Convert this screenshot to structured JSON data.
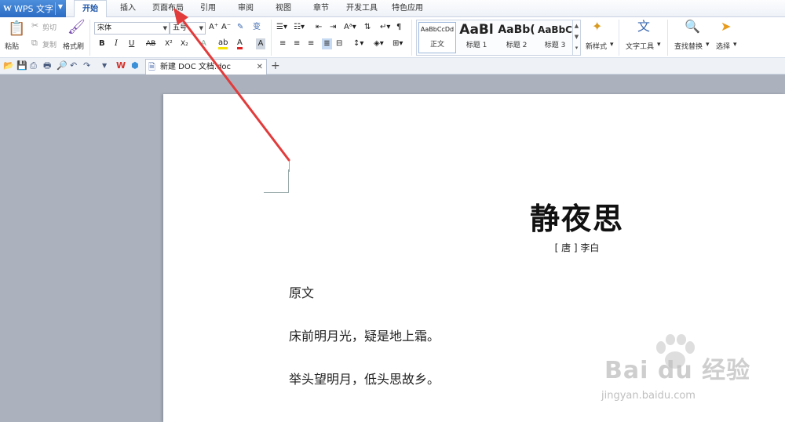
{
  "app": {
    "menu_button_label": "WPS 文字",
    "tabs": [
      {
        "label": "开始",
        "active": true
      },
      {
        "label": "插入"
      },
      {
        "label": "页面布局"
      },
      {
        "label": "引用"
      },
      {
        "label": "审阅"
      },
      {
        "label": "视图"
      },
      {
        "label": "章节"
      },
      {
        "label": "开发工具"
      },
      {
        "label": "特色应用"
      }
    ]
  },
  "ribbon": {
    "paste_label": "粘贴",
    "cut_label": "剪切",
    "copy_label": "复制",
    "format_painter_label": "格式刷",
    "font_name": "宋体",
    "font_size": "五号",
    "bold": "B",
    "italic": "I",
    "underline": "U",
    "strikethrough": "AB",
    "superscript": "X²",
    "subscript": "X₂",
    "styles": [
      {
        "sample": "AaBbCcDd",
        "name": "正文",
        "selected": true
      },
      {
        "sample": "AaBl",
        "name": "标题 1"
      },
      {
        "sample": "AaBb(",
        "name": "标题 2"
      },
      {
        "sample": "AaBbC",
        "name": "标题 3"
      }
    ],
    "new_style_label": "新样式",
    "text_tools_label": "文字工具",
    "find_replace_label": "查找替换",
    "select_label": "选择"
  },
  "document_tab": {
    "filename": "新建 DOC 文档.doc"
  },
  "document": {
    "title": "静夜思",
    "author": "[ 唐 ] 李白",
    "paragraphs": [
      "原文",
      "床前明月光，疑是地上霜。",
      "举头望明月，低头思故乡。"
    ]
  },
  "watermark": {
    "brand": "Bai du 经验",
    "url": "jingyan.baidu.com"
  },
  "colors": {
    "wps_blue": "#2c6cc4",
    "annotation_red": "#e23b3b",
    "workspace_gray": "#abb2be"
  }
}
